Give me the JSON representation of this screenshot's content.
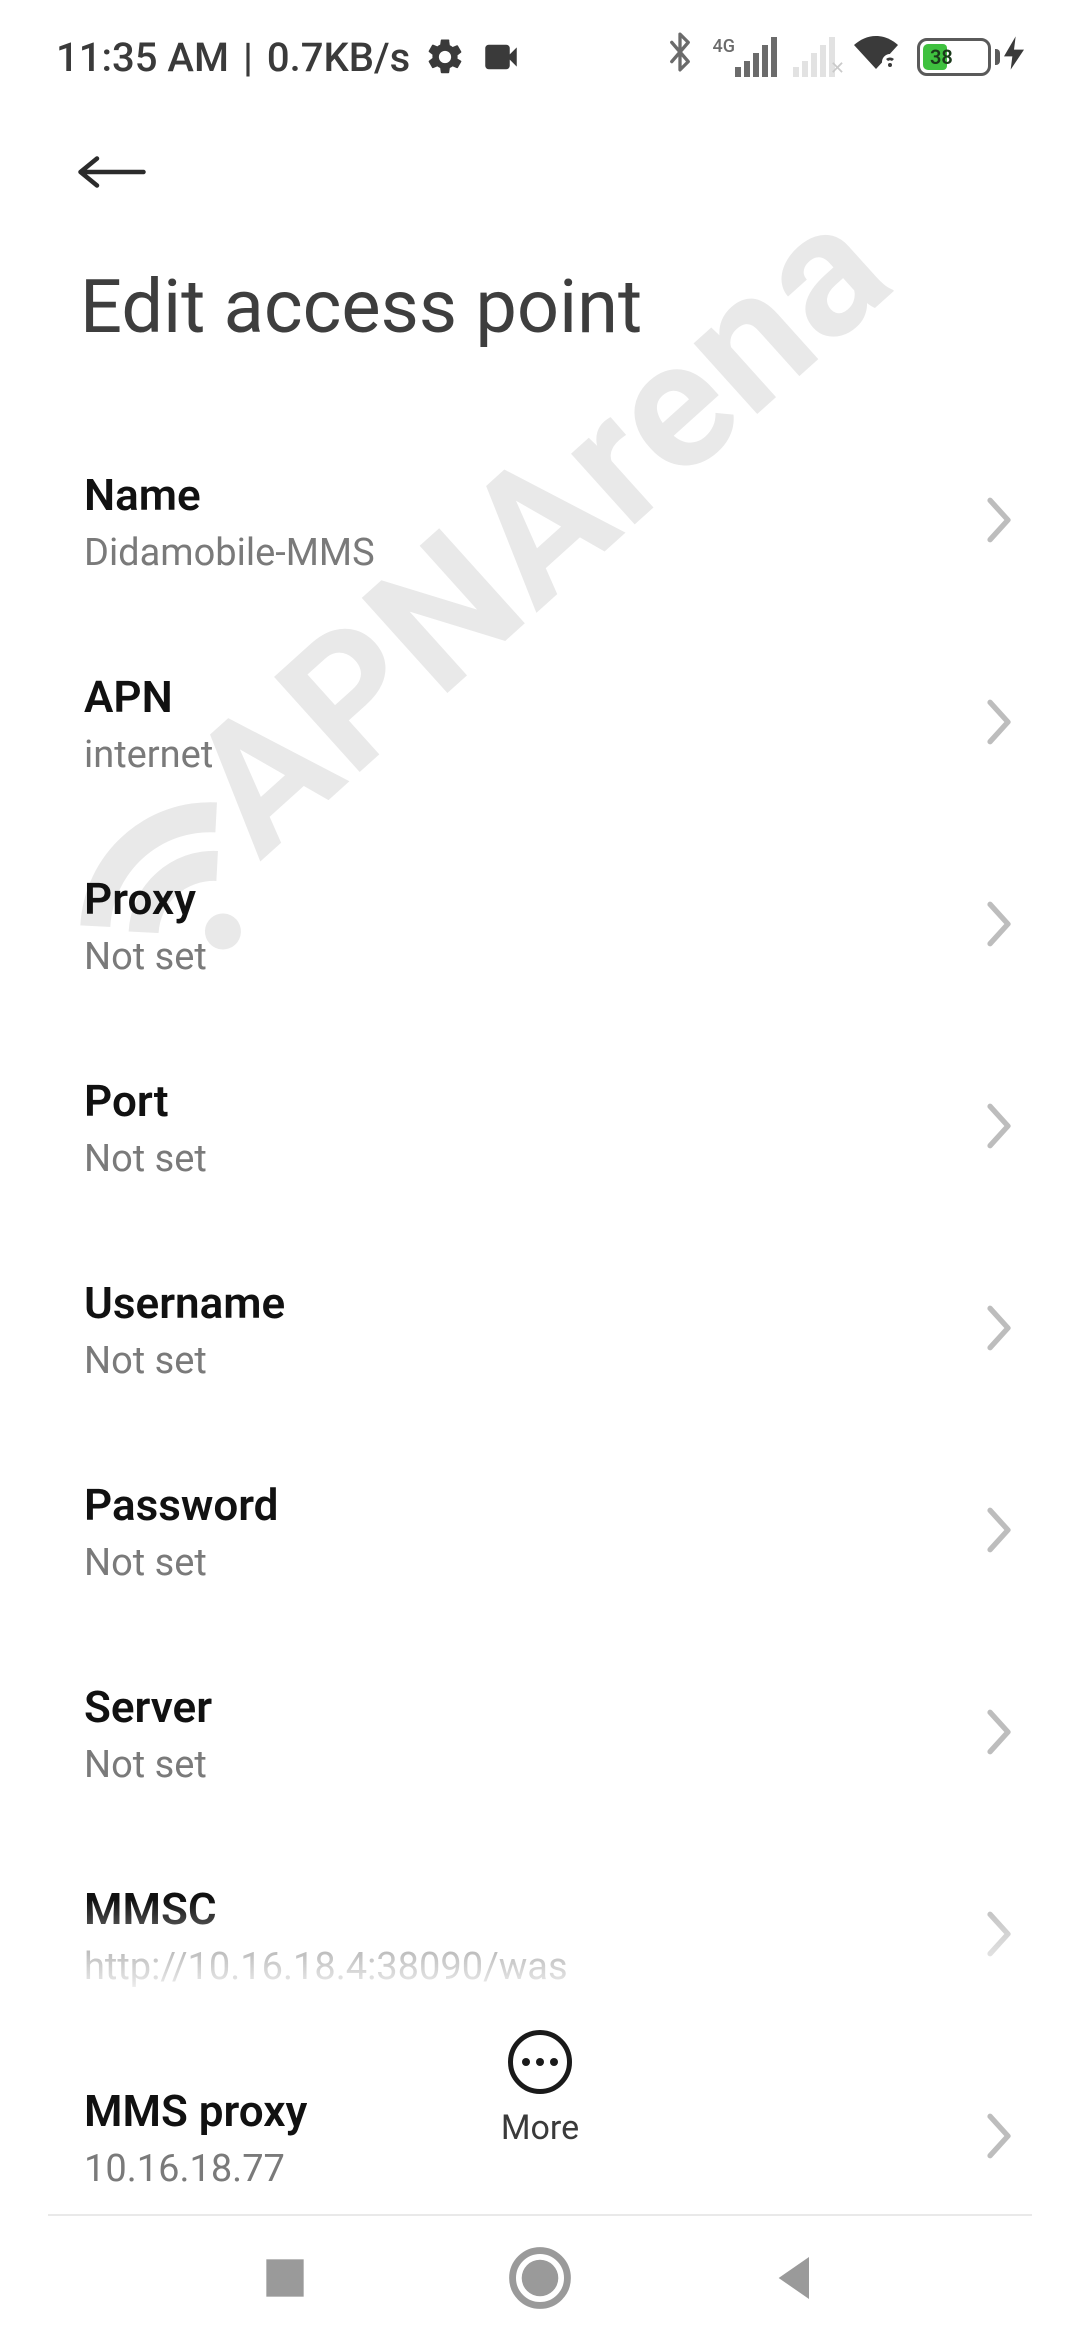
{
  "status_bar": {
    "time": "11:35 AM",
    "separator": "|",
    "net_speed": "0.7KB/s",
    "network_label": "4G",
    "battery_percent": "38"
  },
  "header": {
    "title": "Edit access point"
  },
  "settings": [
    {
      "key": "name",
      "title": "Name",
      "value": "Didamobile-MMS"
    },
    {
      "key": "apn",
      "title": "APN",
      "value": "internet"
    },
    {
      "key": "proxy",
      "title": "Proxy",
      "value": "Not set"
    },
    {
      "key": "port",
      "title": "Port",
      "value": "Not set"
    },
    {
      "key": "username",
      "title": "Username",
      "value": "Not set"
    },
    {
      "key": "password",
      "title": "Password",
      "value": "Not set"
    },
    {
      "key": "server",
      "title": "Server",
      "value": "Not set"
    },
    {
      "key": "mmsc",
      "title": "MMSC",
      "value": "http://10.16.18.4:38090/was"
    },
    {
      "key": "mms_proxy",
      "title": "MMS proxy",
      "value": "10.16.18.77"
    }
  ],
  "footer": {
    "more_label": "More"
  },
  "watermark": {
    "text": "APNArena"
  }
}
